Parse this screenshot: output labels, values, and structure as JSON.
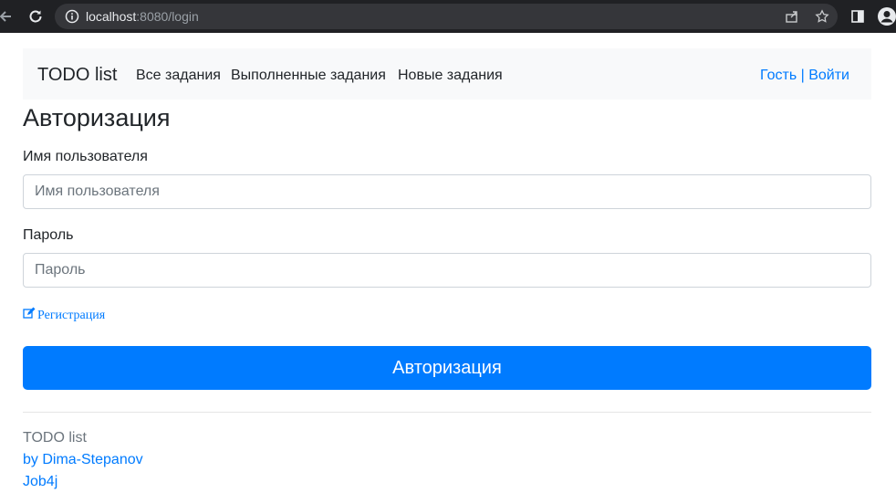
{
  "browser": {
    "url_host": "localhost",
    "url_rest": ":8080/login"
  },
  "navbar": {
    "brand": "TODO list",
    "links": [
      "Все задания",
      "Выполненные задания",
      "Новые задания"
    ],
    "user": "Гость | Войти"
  },
  "form": {
    "title": "Авторизация",
    "username_label": "Имя пользователя",
    "username_placeholder": "Имя пользователя",
    "password_label": "Пароль",
    "password_placeholder": "Пароль",
    "register_link": "Регистрация",
    "submit_label": "Авторизация"
  },
  "footer": {
    "line1": "TODO list",
    "line2": "by Dima-Stepanov",
    "line3": "Job4j"
  },
  "colors": {
    "primary": "#007bff",
    "navbar_bg": "#f8f9fa",
    "chrome_bg": "#202124"
  }
}
